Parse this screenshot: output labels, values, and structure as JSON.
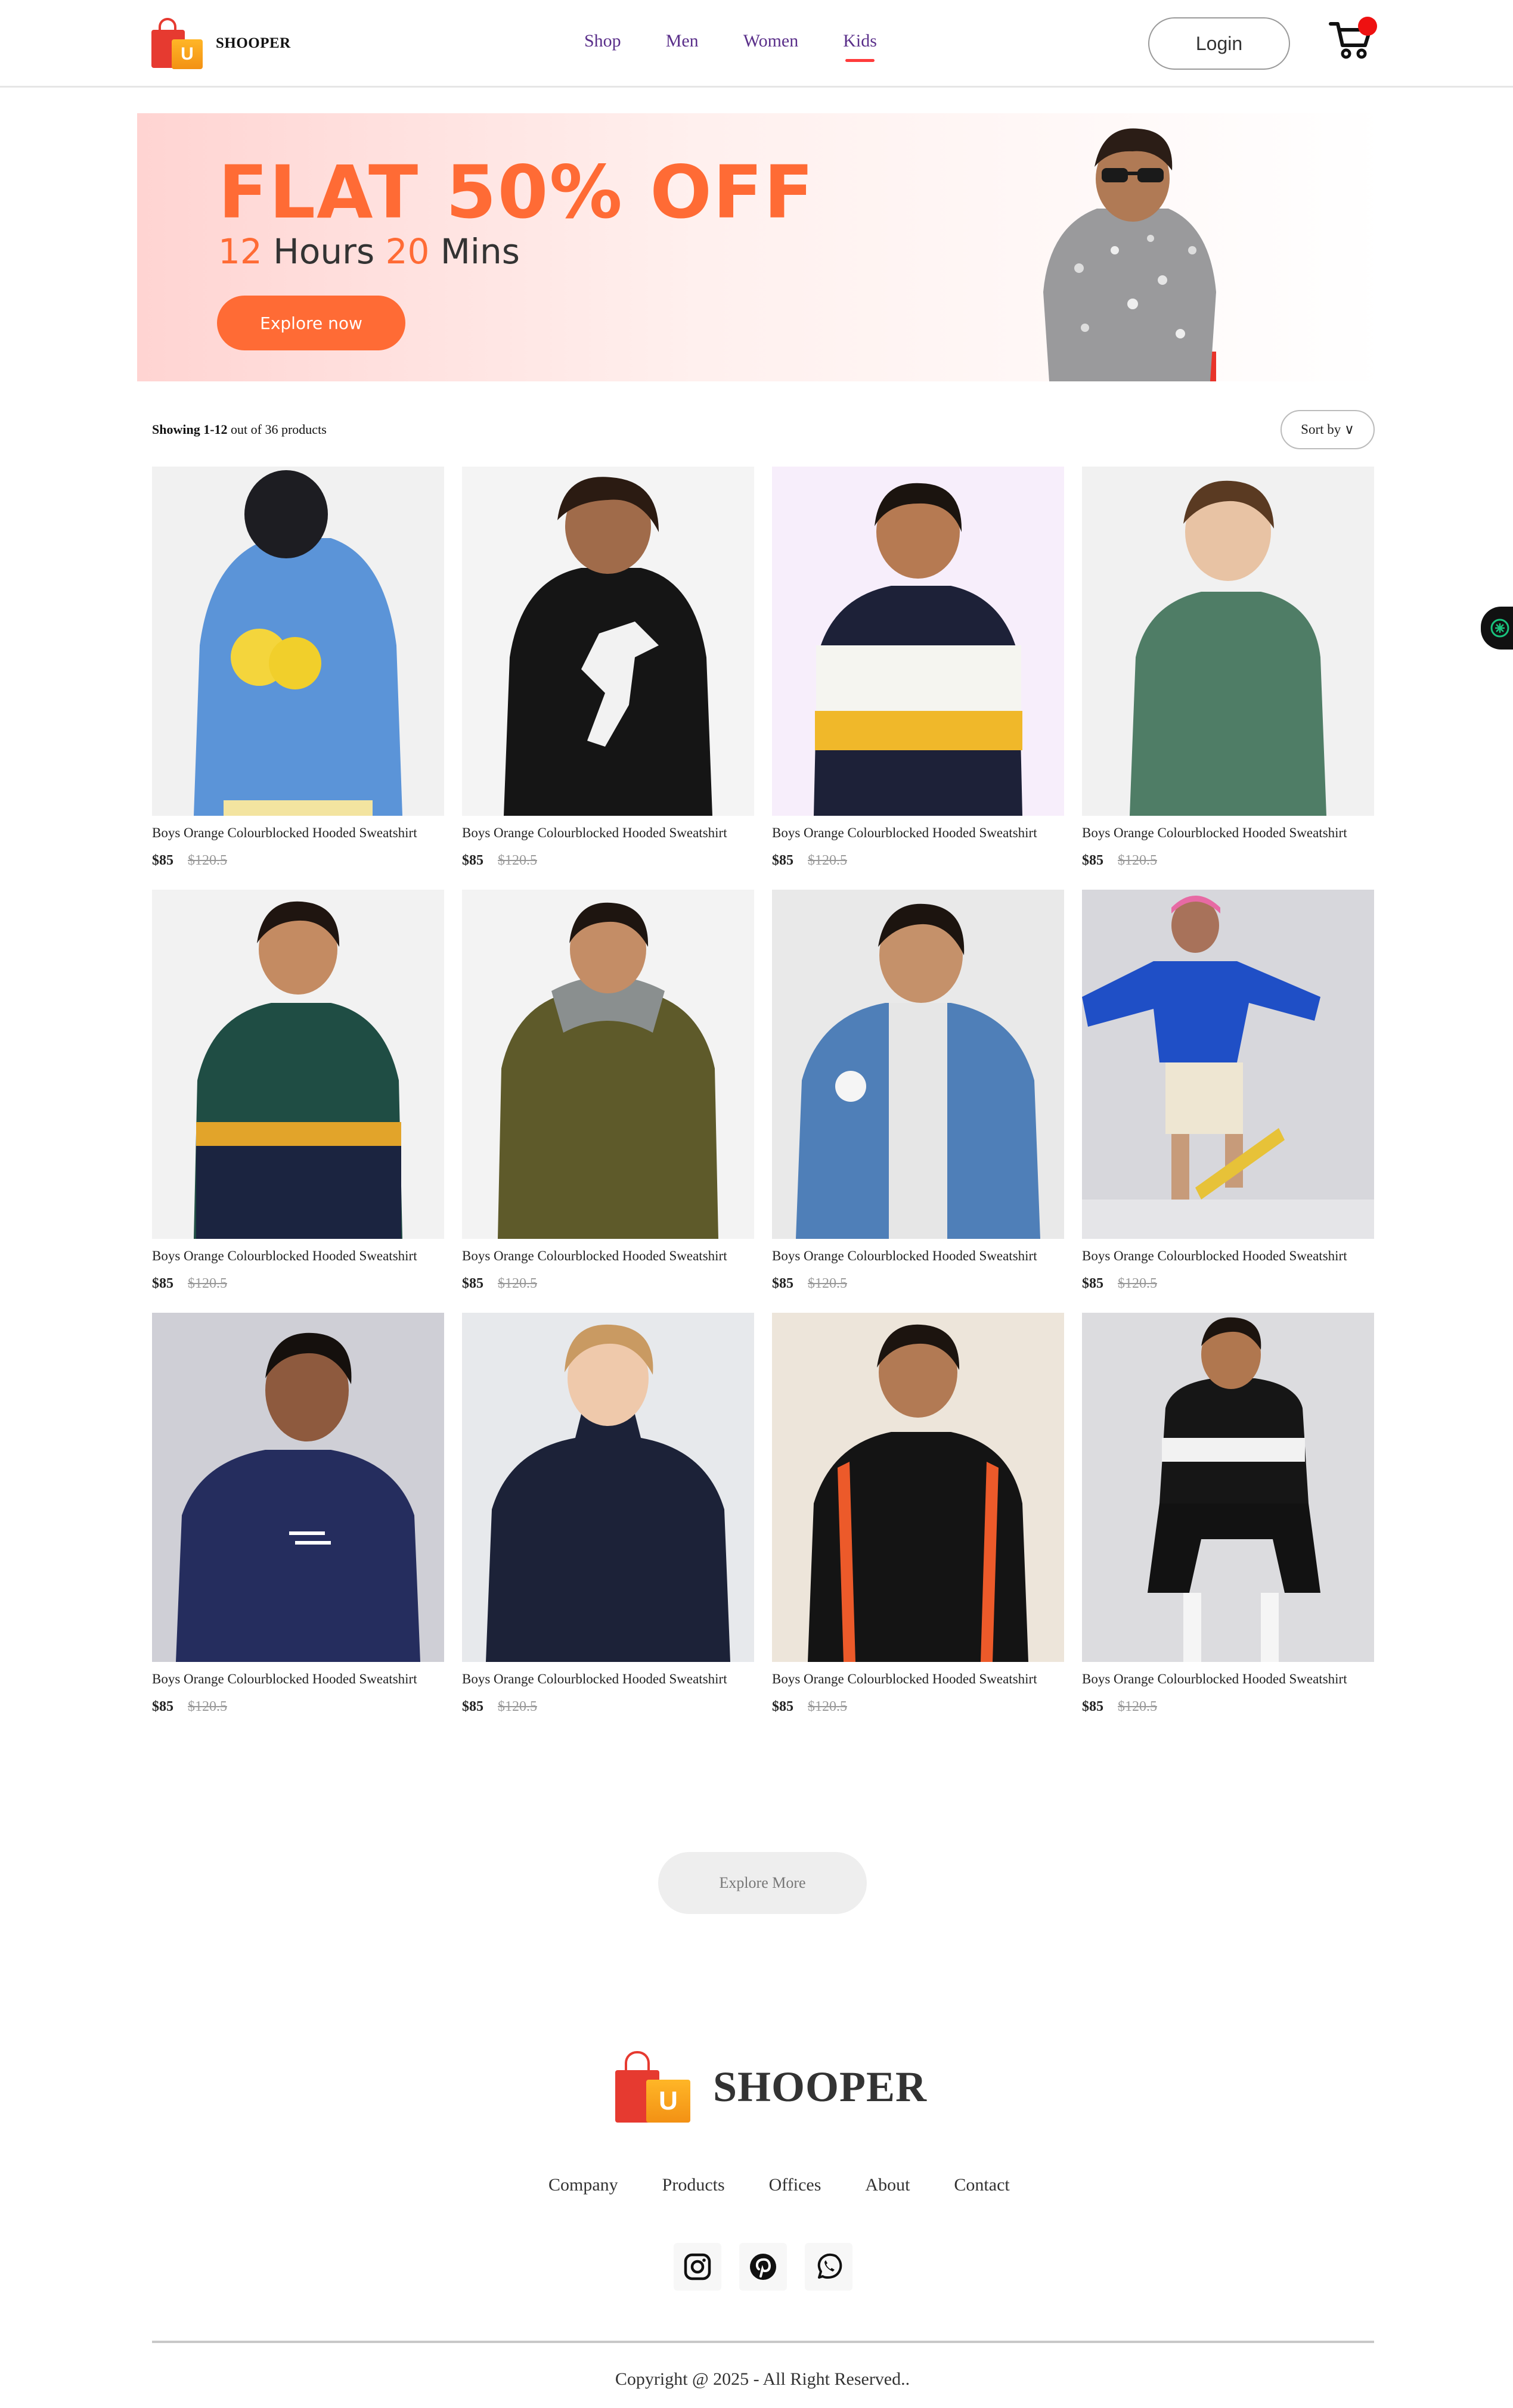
{
  "header": {
    "brand": "SHOOPER",
    "logo_letter": "U",
    "nav": [
      {
        "label": "Shop",
        "active": false
      },
      {
        "label": "Men",
        "active": false
      },
      {
        "label": "Women",
        "active": false
      },
      {
        "label": "Kids",
        "active": true
      }
    ],
    "login_label": "Login",
    "cart_icon": "cart-icon"
  },
  "hero": {
    "title": "FLAT 50% OFF",
    "hours_value": "12",
    "hours_unit": "Hours",
    "mins_value": "20",
    "mins_unit": "Mins",
    "button_label": "Explore now",
    "accent_color": "#ff6b35"
  },
  "listing": {
    "showing_range": "Showing 1-12",
    "showing_total": "out of 36 products",
    "sort_label": "Sort by"
  },
  "products": [
    {
      "name": "Boys Orange Colourblocked Hooded Sweatshirt",
      "price": "$85",
      "old_price": "$120.5",
      "image": "blue-hoodie-lemon-back"
    },
    {
      "name": "Boys Orange Colourblocked Hooded Sweatshirt",
      "price": "$85",
      "old_price": "$120.5",
      "image": "black-hoodie-footballer-print"
    },
    {
      "name": "Boys Orange Colourblocked Hooded Sweatshirt",
      "price": "$85",
      "old_price": "$120.5",
      "image": "navy-white-yellow-hoodie"
    },
    {
      "name": "Boys Orange Colourblocked Hooded Sweatshirt",
      "price": "$85",
      "old_price": "$120.5",
      "image": "green-sweatshirt"
    },
    {
      "name": "Boys Orange Colourblocked Hooded Sweatshirt",
      "price": "$85",
      "old_price": "$120.5",
      "image": "green-navy-track-jacket"
    },
    {
      "name": "Boys Orange Colourblocked Hooded Sweatshirt",
      "price": "$85",
      "old_price": "$120.5",
      "image": "olive-quilted-jacket"
    },
    {
      "name": "Boys Orange Colourblocked Hooded Sweatshirt",
      "price": "$85",
      "old_price": "$120.5",
      "image": "denim-bomber-jacket"
    },
    {
      "name": "Boys Orange Colourblocked Hooded Sweatshirt",
      "price": "$85",
      "old_price": "$120.5",
      "image": "blue-sweatshirt-skateboard"
    },
    {
      "name": "Boys Orange Colourblocked Hooded Sweatshirt",
      "price": "$85",
      "old_price": "$120.5",
      "image": "navy-sweatshirt"
    },
    {
      "name": "Boys Orange Colourblocked Hooded Sweatshirt",
      "price": "$85",
      "old_price": "$120.5",
      "image": "navy-jacket"
    },
    {
      "name": "Boys Orange Colourblocked Hooded Sweatshirt",
      "price": "$85",
      "old_price": "$120.5",
      "image": "black-orange-track-jacket"
    },
    {
      "name": "Boys Orange Colourblocked Hooded Sweatshirt",
      "price": "$85",
      "old_price": "$120.5",
      "image": "black-white-bomber"
    }
  ],
  "explore_more_label": "Explore More",
  "footer": {
    "brand": "SHOOPER",
    "links": [
      "Company",
      "Products",
      "Offices",
      "About",
      "Contact"
    ],
    "socials": [
      "instagram-icon",
      "pinterest-icon",
      "whatsapp-icon"
    ],
    "copyright": "Copyright @ 2025 - All Right Reserved.."
  }
}
